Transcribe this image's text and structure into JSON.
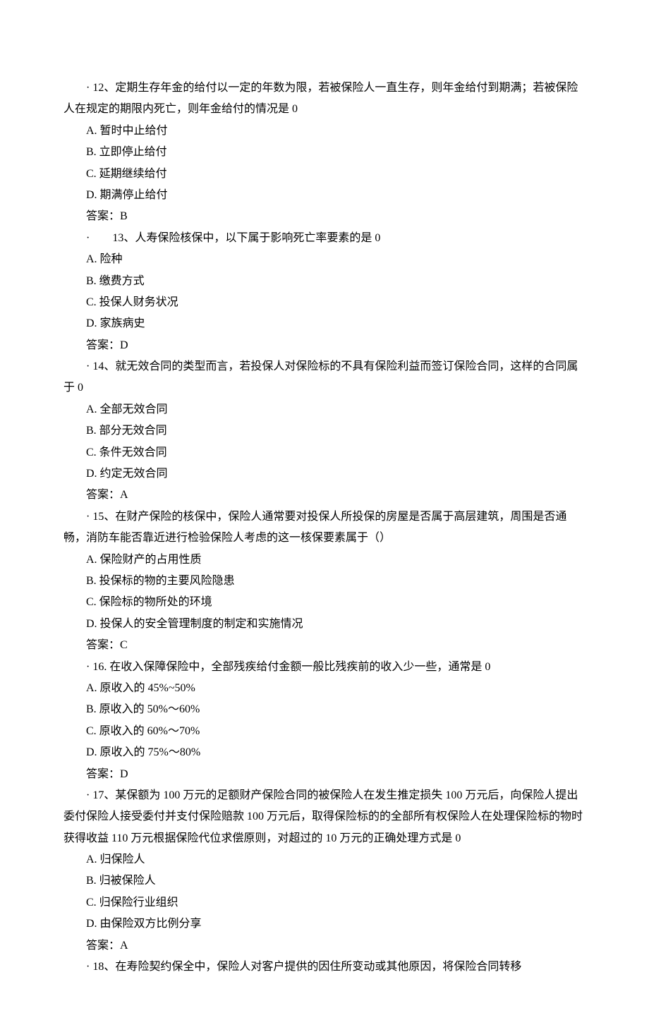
{
  "questions": [
    {
      "prompt": "· 12、定期生存年金的给付以一定的年数为限，若被保险人一直生存，则年金给付到期满；若被保险人在规定的期限内死亡，则年金给付的情况是 0",
      "options": [
        "A. 暂时中止给付",
        "B. 立即停止给付",
        "C. 延期继续给付",
        "D. 期满停止给付"
      ],
      "answer": "答案：B"
    },
    {
      "prompt": "·　　13、人寿保险核保中，以下属于影响死亡率要素的是 0",
      "options": [
        "A. 险种",
        "B. 缴费方式",
        "C. 投保人财务状况",
        "D. 家族病史"
      ],
      "answer": "答案：D"
    },
    {
      "prompt": "· 14、就无效合同的类型而言，若投保人对保险标的不具有保险利益而签订保险合同，这样的合同属于 0",
      "options": [
        "A. 全部无效合同",
        "B. 部分无效合同",
        "C. 条件无效合同",
        "D. 约定无效合同"
      ],
      "answer": "答案：A"
    },
    {
      "prompt": "· 15、在财产保险的核保中，保险人通常要对投保人所投保的房屋是否属于高层建筑，周围是否通畅，消防车能否靠近进行检验保险人考虑的这一核保要素属于（）",
      "options": [
        "A. 保险财产的占用性质",
        "B. 投保标的物的主要风险隐患",
        "C. 保险标的物所处的环境",
        "D. 投保人的安全管理制度的制定和实施情况"
      ],
      "answer": "答案：C"
    },
    {
      "prompt": "· 16. 在收入保障保险中，全部残疾给付金额一般比残疾前的收入少一些，通常是 0",
      "options": [
        "A. 原收入的 45%~50%",
        "B. 原收入的 50%～60%",
        "C. 原收入的 60%～70%",
        "D. 原收入的 75%～80%"
      ],
      "answer": "答案：D"
    },
    {
      "prompt": "· 17、某保额为 100 万元的足额财产保险合同的被保险人在发生推定损失 100 万元后，向保险人提出委付保险人接受委付并支付保险赔款 100 万元后，取得保险标的的全部所有权保险人在处理保险标的物时获得收益 110 万元根据保险代位求偿原则，对超过的 10 万元的正确处理方式是 0",
      "options": [
        "A. 归保险人",
        "B. 归被保险人",
        "C. 归保险行业组织",
        "D. 由保险双方比例分享"
      ],
      "answer": "答案：A"
    },
    {
      "prompt": "· 18、在寿险契约保全中，保险人对客户提供的因住所变动或其他原因，将保险合同转移",
      "options": [],
      "answer": ""
    }
  ]
}
